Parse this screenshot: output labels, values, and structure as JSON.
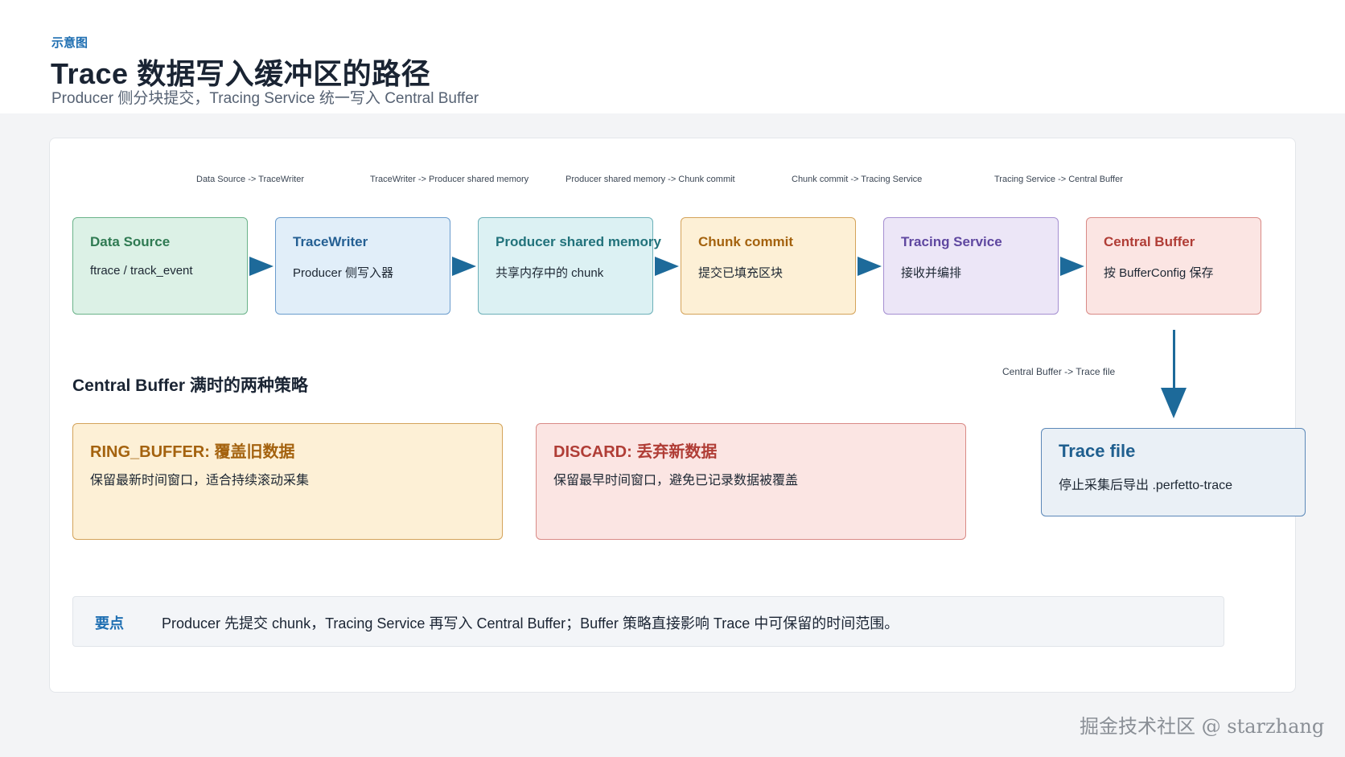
{
  "header": {
    "eyebrow": "示意图",
    "title": "Trace 数据写入缓冲区的路径",
    "subtitle": "Producer 侧分块提交，Tracing Service 统一写入 Central Buffer"
  },
  "flow_labels": [
    "Data Source -> TraceWriter",
    "TraceWriter -> Producer shared memory",
    "Producer shared memory -> Chunk commit",
    "Chunk commit -> Tracing Service",
    "Tracing Service -> Central Buffer"
  ],
  "nodes": [
    {
      "title": "Data Source",
      "subtitle": "ftrace / track_event",
      "bg": "#dcf1e6",
      "border": "#6bb38a",
      "title_color": "#2f7a52"
    },
    {
      "title": "TraceWriter",
      "subtitle": "Producer 侧写入器",
      "bg": "#e1eef9",
      "border": "#6a9ccd",
      "title_color": "#245f93"
    },
    {
      "title": "Producer shared memory",
      "subtitle": "共享内存中的 chunk",
      "bg": "#dcf1f3",
      "border": "#6cb0b8",
      "title_color": "#21727b"
    },
    {
      "title": "Chunk commit",
      "subtitle": "提交已填充区块",
      "bg": "#fdf0d6",
      "border": "#d4a35a",
      "title_color": "#a4620e"
    },
    {
      "title": "Tracing Service",
      "subtitle": "接收并编排",
      "bg": "#ece6f7",
      "border": "#a58fd1",
      "title_color": "#5f47a0"
    },
    {
      "title": "Central Buffer",
      "subtitle": "按 BufferConfig 保存",
      "bg": "#fbe5e3",
      "border": "#d98a86",
      "title_color": "#b03d36"
    }
  ],
  "down_label": "Central Buffer -> Trace file",
  "section_title": "Central Buffer 满时的两种策略",
  "policies": [
    {
      "title": "RING_BUFFER: 覆盖旧数据",
      "desc": "保留最新时间窗口，适合持续滚动采集",
      "bg": "#fdf0d6",
      "border": "#d4a35a",
      "title_color": "#a4620e"
    },
    {
      "title": "DISCARD: 丢弃新数据",
      "desc": "保留最早时间窗口，避免已记录数据被覆盖",
      "bg": "#fbe5e3",
      "border": "#d98a86",
      "title_color": "#b03d36"
    }
  ],
  "trace_file": {
    "title": "Trace file",
    "subtitle": "停止采集后导出 .perfetto-trace"
  },
  "keypoint": {
    "label": "要点",
    "text": "Producer 先提交 chunk，Tracing Service 再写入 Central Buffer；Buffer 策略直接影响 Trace 中可保留的时间范围。"
  },
  "watermark": "掘金技术社区 @ starzhang"
}
